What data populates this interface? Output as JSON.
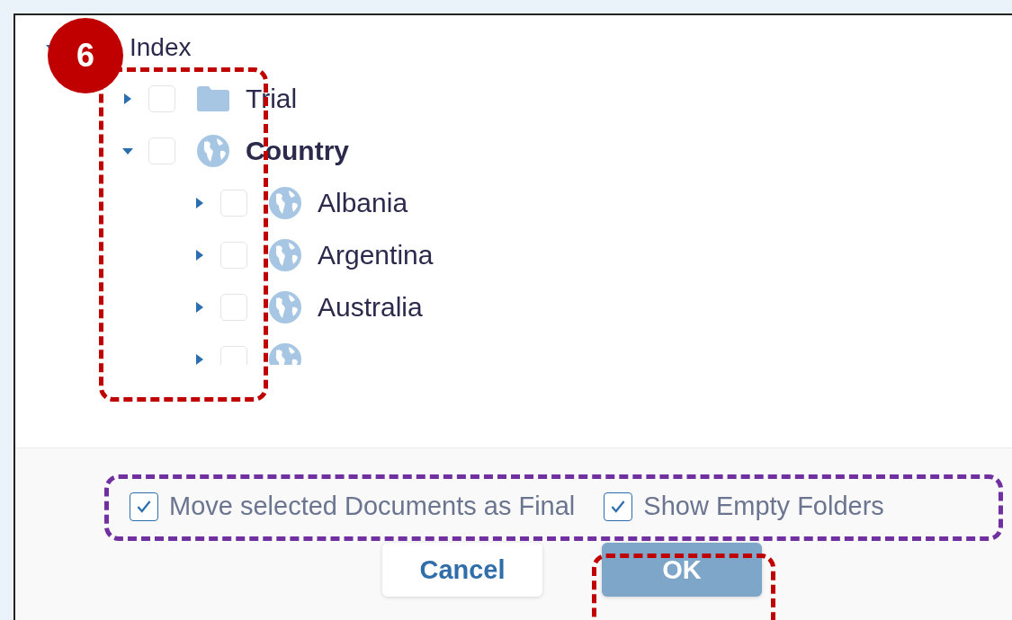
{
  "tree": [
    {
      "label": "Index",
      "kind": "root",
      "expanded": true,
      "children": [
        {
          "label": "Trial",
          "kind": "folder",
          "expanded": false,
          "checked": false,
          "bold": false
        },
        {
          "label": "Country",
          "kind": "globe",
          "expanded": true,
          "checked": false,
          "bold": true,
          "children": [
            {
              "label": "Albania",
              "kind": "globe",
              "expanded": false,
              "checked": false,
              "bold": false
            },
            {
              "label": "Argentina",
              "kind": "globe",
              "expanded": false,
              "checked": false,
              "bold": false
            },
            {
              "label": "Australia",
              "kind": "globe",
              "expanded": false,
              "checked": false,
              "bold": false
            },
            {
              "kind": "globe",
              "expanded": false,
              "checked": false
            }
          ]
        }
      ]
    }
  ],
  "options": [
    {
      "label": "Move selected Documents as Final",
      "checked": true
    },
    {
      "label": "Show Empty Folders",
      "checked": true
    }
  ],
  "buttons": [
    {
      "label": "Cancel",
      "kind": "secondary"
    },
    {
      "label": "OK",
      "kind": "primary"
    }
  ],
  "callout": {
    "number": "6"
  }
}
